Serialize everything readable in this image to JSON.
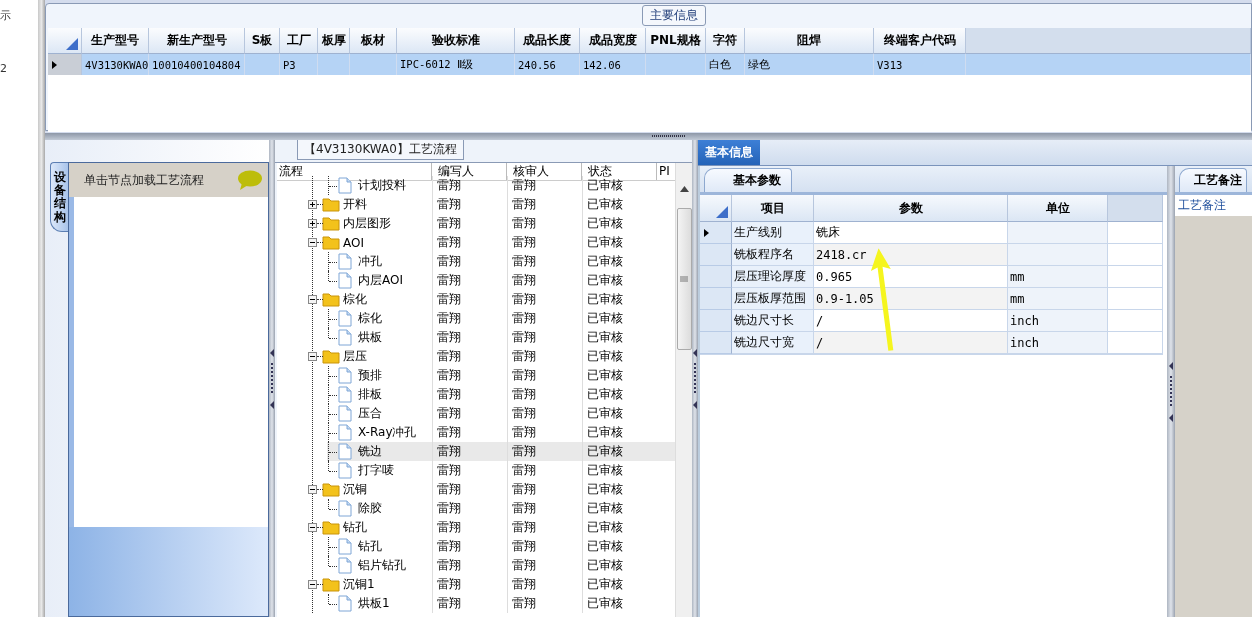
{
  "left_strip": [
    "示",
    "2"
  ],
  "main_info": {
    "title": "主要信息",
    "columns": [
      "生产型号",
      "新生产型号",
      "S板",
      "工厂",
      "板厚",
      "板材",
      "验收标准",
      "成品长度",
      "成品宽度",
      "PNL规格",
      "字符",
      "阻焊",
      "终端客户代码"
    ],
    "rows": [
      {
        "selected": true,
        "cells": [
          "4V3130KWA0",
          "10010400104804",
          "",
          "P3",
          "",
          "",
          "IPC-6012 Ⅱ级",
          "240.56",
          "142.06",
          "",
          "白色",
          "绿色",
          "V313"
        ]
      }
    ]
  },
  "side_tab": {
    "label": "设备结构"
  },
  "hint": {
    "text": "单击节点加载工艺流程"
  },
  "process": {
    "title": "【4V3130KWA0】工艺流程",
    "columns": [
      "流程",
      "编写人",
      "核审人",
      "状态",
      "PI"
    ],
    "rows": [
      {
        "kind": "file",
        "label": "计划投料",
        "writer": "雷翔",
        "reviewer": "雷翔",
        "status": "已审核",
        "selected": false
      },
      {
        "kind": "folder",
        "label": "开料",
        "writer": "雷翔",
        "reviewer": "雷翔",
        "status": "已审核",
        "selected": false,
        "expanded": false
      },
      {
        "kind": "folder",
        "label": "内层图形",
        "writer": "雷翔",
        "reviewer": "雷翔",
        "status": "已审核",
        "selected": false,
        "expanded": false
      },
      {
        "kind": "folder",
        "label": "AOI",
        "writer": "雷翔",
        "reviewer": "雷翔",
        "status": "已审核",
        "selected": false,
        "expanded": true,
        "children": [
          {
            "kind": "file",
            "label": "冲孔",
            "writer": "雷翔",
            "reviewer": "雷翔",
            "status": "已审核",
            "selected": false
          },
          {
            "kind": "file",
            "label": "内层AOI",
            "writer": "雷翔",
            "reviewer": "雷翔",
            "status": "已审核",
            "selected": false
          }
        ]
      },
      {
        "kind": "folder",
        "label": "棕化",
        "writer": "雷翔",
        "reviewer": "雷翔",
        "status": "已审核",
        "selected": false,
        "expanded": true,
        "children": [
          {
            "kind": "file",
            "label": "棕化",
            "writer": "雷翔",
            "reviewer": "雷翔",
            "status": "已审核",
            "selected": false
          },
          {
            "kind": "file",
            "label": "烘板",
            "writer": "雷翔",
            "reviewer": "雷翔",
            "status": "已审核",
            "selected": false
          }
        ]
      },
      {
        "kind": "folder",
        "label": "层压",
        "writer": "雷翔",
        "reviewer": "雷翔",
        "status": "已审核",
        "selected": false,
        "expanded": true,
        "children": [
          {
            "kind": "file",
            "label": "预排",
            "writer": "雷翔",
            "reviewer": "雷翔",
            "status": "已审核",
            "selected": false
          },
          {
            "kind": "file",
            "label": "排板",
            "writer": "雷翔",
            "reviewer": "雷翔",
            "status": "已审核",
            "selected": false
          },
          {
            "kind": "file",
            "label": "压合",
            "writer": "雷翔",
            "reviewer": "雷翔",
            "status": "已审核",
            "selected": false
          },
          {
            "kind": "file",
            "label": "X-Ray冲孔",
            "writer": "雷翔",
            "reviewer": "雷翔",
            "status": "已审核",
            "selected": false
          },
          {
            "kind": "file",
            "label": "铣边",
            "writer": "雷翔",
            "reviewer": "雷翔",
            "status": "已审核",
            "selected": true
          },
          {
            "kind": "file",
            "label": "打字唛",
            "writer": "雷翔",
            "reviewer": "雷翔",
            "status": "已审核",
            "selected": false
          }
        ]
      },
      {
        "kind": "folder",
        "label": "沉铜",
        "writer": "雷翔",
        "reviewer": "雷翔",
        "status": "已审核",
        "selected": false,
        "expanded": true,
        "children": [
          {
            "kind": "file",
            "label": "除胶",
            "writer": "雷翔",
            "reviewer": "雷翔",
            "status": "已审核",
            "selected": false
          }
        ]
      },
      {
        "kind": "folder",
        "label": "钻孔",
        "writer": "雷翔",
        "reviewer": "雷翔",
        "status": "已审核",
        "selected": false,
        "expanded": true,
        "children": [
          {
            "kind": "file",
            "label": "钻孔",
            "writer": "雷翔",
            "reviewer": "雷翔",
            "status": "已审核",
            "selected": false
          },
          {
            "kind": "file",
            "label": "铝片钻孔",
            "writer": "雷翔",
            "reviewer": "雷翔",
            "status": "已审核",
            "selected": false
          }
        ]
      },
      {
        "kind": "folder",
        "label": "沉铜1",
        "writer": "雷翔",
        "reviewer": "雷翔",
        "status": "已审核",
        "selected": false,
        "expanded": true,
        "children": [
          {
            "kind": "file",
            "label": "烘板1",
            "writer": "雷翔",
            "reviewer": "雷翔",
            "status": "已审核",
            "selected": false
          }
        ]
      }
    ]
  },
  "info_tab": {
    "label": "基本信息",
    "selected": true
  },
  "params": {
    "tab": "基本参数",
    "columns": [
      "项目",
      "参数",
      "单位"
    ],
    "rows": [
      {
        "selected": true,
        "item": "生产线别",
        "value": "铣床",
        "unit": ""
      },
      {
        "selected": false,
        "item": "铣板程序名",
        "value": "2418.cr",
        "unit": ""
      },
      {
        "selected": false,
        "item": "层压理论厚度",
        "value": "0.965",
        "unit": "mm"
      },
      {
        "selected": false,
        "item": "层压板厚范围",
        "value": "0.9-1.05",
        "unit": "mm"
      },
      {
        "selected": false,
        "item": "铣边尺寸长",
        "value": "/",
        "unit": "inch"
      },
      {
        "selected": false,
        "item": "铣边尺寸宽",
        "value": "/",
        "unit": "inch"
      }
    ]
  },
  "notes": {
    "tab": "工艺备注",
    "label": "工艺备注"
  }
}
